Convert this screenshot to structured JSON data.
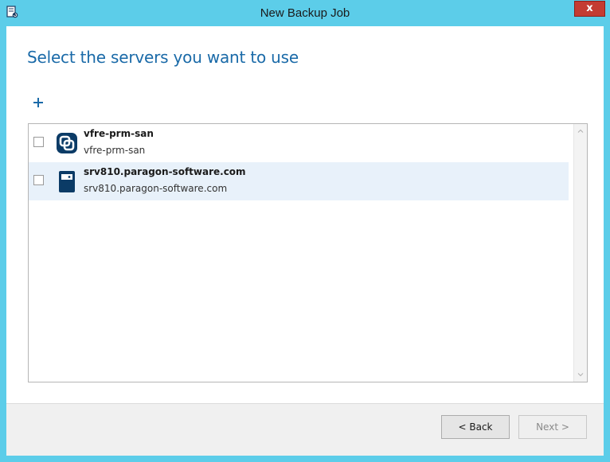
{
  "window": {
    "title": "New Backup Job",
    "close_label": "x"
  },
  "heading": "Select the servers you want to use",
  "add_button_label": "+",
  "servers": [
    {
      "name": "vfre-prm-san",
      "host": "vfre-prm-san",
      "icon": "vmware-vsphere-icon",
      "selected": false,
      "checked": false
    },
    {
      "name": "srv810.paragon-software.com",
      "host": "srv810.paragon-software.com",
      "icon": "server-icon",
      "selected": true,
      "checked": false
    }
  ],
  "footer": {
    "back_label": "< Back",
    "next_label": "Next >"
  },
  "colors": {
    "titlebar": "#5ccde9",
    "heading": "#1a6aa8",
    "close": "#c43c32",
    "selection": "#e8f1fa"
  }
}
